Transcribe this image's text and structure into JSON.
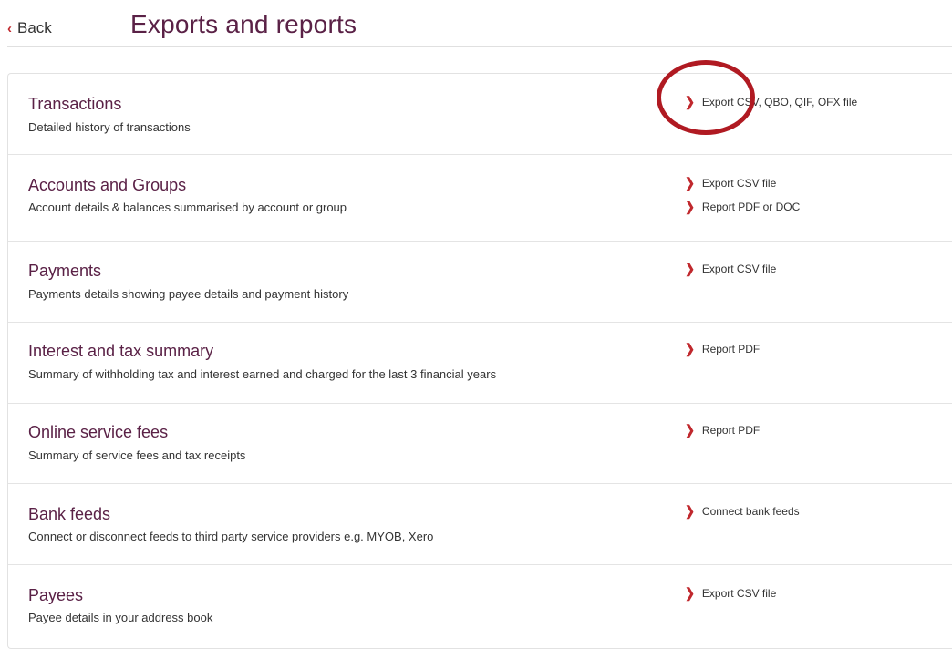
{
  "header": {
    "back_label": "Back",
    "title": "Exports and reports"
  },
  "rows": [
    {
      "title": "Transactions",
      "desc": "Detailed history of transactions",
      "links": [
        "Export CSV, QBO, QIF, OFX file"
      ]
    },
    {
      "title": "Accounts and Groups",
      "desc": "Account details & balances summarised by account or group",
      "links": [
        "Export CSV file",
        "Report PDF or DOC"
      ]
    },
    {
      "title": "Payments",
      "desc": "Payments details showing payee details and payment history",
      "links": [
        "Export CSV file"
      ]
    },
    {
      "title": "Interest and tax summary",
      "desc": "Summary of withholding tax and interest earned and charged for the last 3 financial years",
      "links": [
        "Report PDF"
      ]
    },
    {
      "title": "Online service fees",
      "desc": "Summary of service fees and tax receipts",
      "links": [
        "Report PDF"
      ]
    },
    {
      "title": "Bank feeds",
      "desc": "Connect or disconnect feeds to third party service providers e.g. MYOB, Xero",
      "links": [
        "Connect bank feeds"
      ]
    },
    {
      "title": "Payees",
      "desc": "Payee details in your address book",
      "links": [
        "Export CSV file"
      ]
    }
  ],
  "colors": {
    "title": "#5a2146",
    "chevron": "#c0282d",
    "annotation": "#b01a22"
  },
  "icons": {
    "back": "chevron-left-icon",
    "link": "chevron-right-icon"
  }
}
